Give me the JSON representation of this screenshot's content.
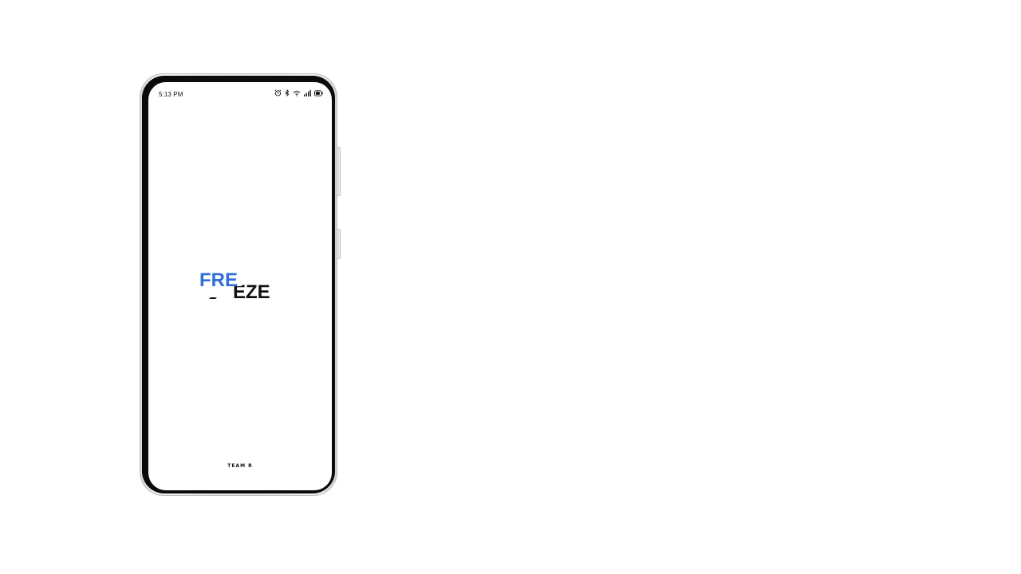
{
  "status_bar": {
    "time": "5:13 PM",
    "icons": [
      "alarm-icon",
      "bluetooth-icon",
      "wifi-icon",
      "signal-icon",
      "battery-icon"
    ]
  },
  "splash": {
    "logo_top": "FRE",
    "logo_bottom": "EZE",
    "logo_colors": {
      "top": "#2f6fd6",
      "bottom": "#111111"
    },
    "footer_brand": "TEAM R"
  }
}
